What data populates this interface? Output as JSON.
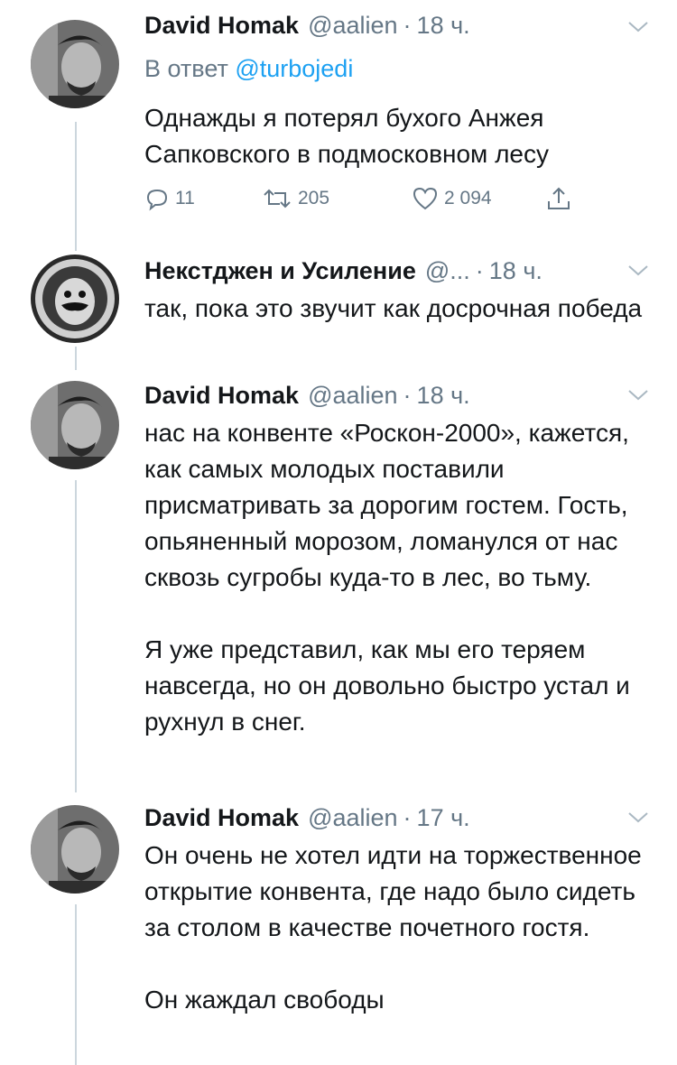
{
  "tweets": [
    {
      "name": "David Homak",
      "handle": "@aalien",
      "separator": "·",
      "time": "18 ч.",
      "reply_prefix": "В ответ",
      "reply_to": "@turbojedi",
      "paragraphs": [
        "Однажды я потерял бухого Анжея Сапковского в подмосковном лесу"
      ],
      "actions": {
        "replies": "11",
        "retweets": "205",
        "likes": "2 094"
      }
    },
    {
      "name": "Некстджен и Усиление",
      "handle": "@...",
      "separator": "·",
      "time": "18 ч.",
      "paragraphs": [
        "так, пока это звучит как досрочная победа"
      ]
    },
    {
      "name": "David Homak",
      "handle": "@aalien",
      "separator": "·",
      "time": "18 ч.",
      "paragraphs": [
        "нас на конвенте «Роскон-2000», кажется, как самых молодых поставили присматривать за дорогим гостем. Гость, опьяненный морозом, ломанулся от нас сквозь сугробы куда-то в лес, во тьму.",
        "Я уже представил, как мы его теряем навсегда, но он довольно быстро устал и рухнул в снег."
      ]
    },
    {
      "name": "David Homak",
      "handle": "@aalien",
      "separator": "·",
      "time": "17 ч.",
      "paragraphs": [
        "Он очень не хотел идти на торжественное открытие конвента, где надо было сидеть за столом в качестве почетного гостя.",
        "Он жаждал свободы"
      ]
    }
  ],
  "icons": {
    "reply": "reply-icon",
    "retweet": "retweet-icon",
    "like": "heart-icon",
    "share": "share-icon",
    "menu": "chevron-down-icon"
  },
  "colors": {
    "text": "#14171a",
    "secondary": "#657786",
    "link": "#1da1f2",
    "thread_line": "#ccd6dd"
  }
}
